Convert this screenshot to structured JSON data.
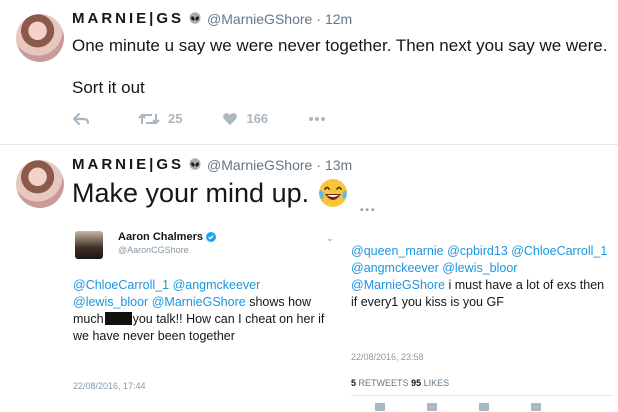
{
  "tweet1": {
    "display_name": "MARNIE|GS",
    "handle": "@MarnieGShore",
    "separator": "·",
    "time": "12m",
    "text_line1": "One minute u say we were never together. Then next you say we were.",
    "text_line2": "Sort it out",
    "retweets": "25",
    "likes": "166"
  },
  "tweet2": {
    "display_name": "MARNIE|GS",
    "handle": "@MarnieGShore",
    "separator": "·",
    "time": "13m",
    "text": "Make your mind up."
  },
  "embed_left": {
    "name": "Aaron Chalmers",
    "handle": "@AaronCGShore",
    "mention1": "@ChloeCarroll_1",
    "mention2": "@angmckeever",
    "mention3": "@lewis_bloor",
    "mention4": "@MarnieGShore",
    "text_a": "shows how much",
    "text_b": "you talk!! How can I cheat on her if we have never been together",
    "date": "22/08/2016, 17:44"
  },
  "embed_right": {
    "mention1": "@queen_marnie",
    "mention2": "@cpbird13",
    "mention3": "@ChloeCarroll_1",
    "mention4": "@angmckeever",
    "mention5": "@lewis_bloor",
    "mention6": "@MarnieGShore",
    "text": "i must have a lot of exs then if every1 you kiss is you GF",
    "date": "22/08/2016, 23:58",
    "retweets_count": "5",
    "retweets_label": "RETWEETS",
    "likes_count": "95",
    "likes_label": "LIKES"
  },
  "colors": {
    "link": "#1b95e0",
    "muted": "#657786",
    "action": "#aab8c2"
  },
  "icons": [
    "alien-icon",
    "reply-icon",
    "retweet-icon",
    "heart-icon",
    "more-icon",
    "laughing-emoji-icon",
    "verified-icon"
  ]
}
